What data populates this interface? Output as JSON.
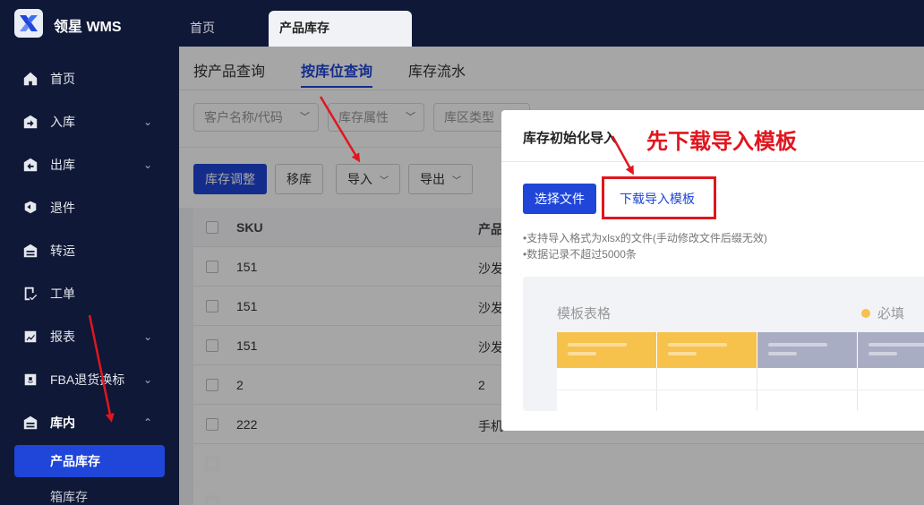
{
  "app": {
    "title": "领星 WMS"
  },
  "top_tabs": [
    {
      "label": "首页"
    },
    {
      "label": "产品库存"
    }
  ],
  "sidebar": {
    "items": [
      {
        "label": "首页",
        "icon": "home-icon"
      },
      {
        "label": "入库",
        "icon": "inbound-icon",
        "chevron": "⌄"
      },
      {
        "label": "出库",
        "icon": "outbound-icon",
        "chevron": "⌄"
      },
      {
        "label": "退件",
        "icon": "return-icon"
      },
      {
        "label": "转运",
        "icon": "transfer-icon"
      },
      {
        "label": "工单",
        "icon": "work-order-icon"
      },
      {
        "label": "报表",
        "icon": "report-icon",
        "chevron": "⌄"
      },
      {
        "label": "FBA退货换标",
        "icon": "fba-icon",
        "chevron": "⌄"
      },
      {
        "label": "库内",
        "icon": "warehouse-icon",
        "chevron": "⌃"
      }
    ],
    "sub_items": [
      {
        "label": "产品库存"
      },
      {
        "label": "箱库存"
      }
    ]
  },
  "sub_tabs": [
    {
      "label": "按产品查询"
    },
    {
      "label": "按库位查询"
    },
    {
      "label": "库存流水"
    }
  ],
  "filters": [
    {
      "placeholder": "客户名称/代码"
    },
    {
      "placeholder": "库存属性"
    },
    {
      "placeholder": "库区类型"
    }
  ],
  "actions": {
    "adjust": "库存调整",
    "move": "移库",
    "import": "导入",
    "export": "导出"
  },
  "table": {
    "columns": [
      "SKU",
      "产品"
    ],
    "rows": [
      {
        "sku": "151",
        "name": "沙发"
      },
      {
        "sku": "151",
        "name": "沙发"
      },
      {
        "sku": "151",
        "name": "沙发"
      },
      {
        "sku": "2",
        "name": "2"
      },
      {
        "sku": "222",
        "name": "手机"
      }
    ]
  },
  "modal": {
    "title": "库存初始化导入",
    "choose_file": "选择文件",
    "download_template": "下载导入模板",
    "hints": [
      "•支持导入格式为xlsx的文件(手动修改文件后缀无效)",
      "•数据记录不超过5000条"
    ],
    "template_title": "模板表格",
    "required_label": "必填"
  },
  "annotation": {
    "text": "先下载导入模板"
  },
  "colors": {
    "primary": "#1f46d8",
    "sidebar_bg": "#0f1836",
    "annotation_red": "#e0161f",
    "required_yellow": "#f7c24b"
  }
}
